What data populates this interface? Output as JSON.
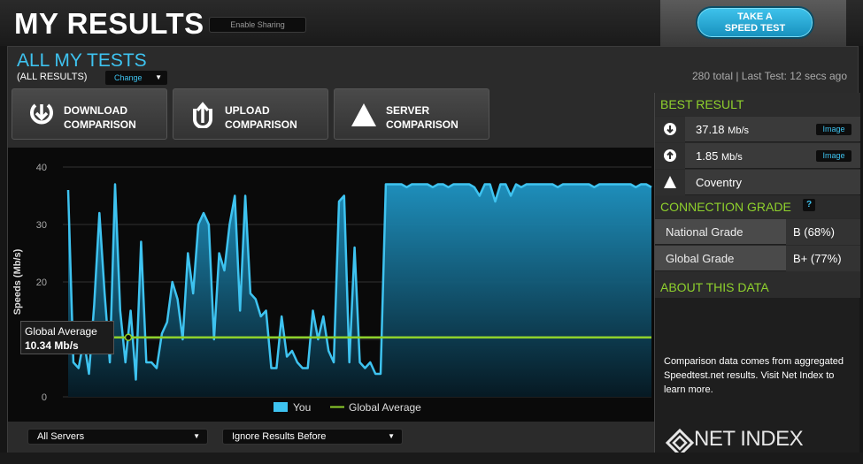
{
  "header": {
    "title": "MY RESULTS",
    "sharing_label": "Enable Sharing",
    "speedtest_line1": "TAKE A",
    "speedtest_line2": "SPEED TEST"
  },
  "section": {
    "title": "ALL MY TESTS",
    "subtitle": "(ALL RESULTS)",
    "change_label": "Change",
    "stats": "280 total | Last Test: 12 secs ago"
  },
  "comparison_buttons": [
    {
      "line1": "DOWNLOAD",
      "line2": "COMPARISON",
      "icon": "download-icon"
    },
    {
      "line1": "UPLOAD",
      "line2": "COMPARISON",
      "icon": "upload-icon"
    },
    {
      "line1": "SERVER",
      "line2": "COMPARISON",
      "icon": "server-icon"
    }
  ],
  "tooltip": {
    "line1": "Global Average",
    "line2": "10.34 Mb/s"
  },
  "filters": {
    "servers": "All Servers",
    "ignore": "Ignore Results Before"
  },
  "best_result": {
    "header": "BEST RESULT",
    "download": "37.18",
    "upload": "1.85",
    "unit": "Mb/s",
    "server": "Coventry",
    "image_label": "Image"
  },
  "connection_grade": {
    "header": "CONNECTION GRADE",
    "help": "?",
    "national_label": "National Grade",
    "national_value": "B (68%)",
    "global_label": "Global Grade",
    "global_value": "B+ (77%)"
  },
  "about": {
    "header": "ABOUT THIS DATA",
    "text": "Comparison data comes from aggregated Speedtest.net results. Visit Net Index to learn more.",
    "logo": "NET INDEX"
  },
  "colors": {
    "accent_blue": "#3ec3f0",
    "accent_green": "#8fd12c",
    "average_line": "#8fd12c"
  },
  "chart_data": {
    "type": "area",
    "ylabel": "Speeds (Mb/s)",
    "ylim": [
      0,
      40
    ],
    "yticks": [
      0,
      10,
      20,
      30,
      40
    ],
    "grid": true,
    "legend_position": "bottom",
    "series": [
      {
        "name": "You",
        "color": "#3ec3f0",
        "values": [
          36,
          6,
          5,
          10,
          4,
          16,
          32,
          18,
          6,
          37,
          15,
          6,
          15,
          3,
          27,
          6,
          6,
          5,
          11,
          13,
          20,
          17,
          10,
          25,
          18,
          30,
          32,
          30,
          10,
          25,
          22,
          30,
          35,
          15,
          35,
          18,
          17,
          14,
          15,
          5,
          5,
          14,
          7,
          8,
          6,
          5,
          5,
          15,
          10,
          14,
          8,
          6,
          34,
          35,
          6,
          26,
          6,
          5,
          6,
          4,
          4,
          37,
          37,
          37,
          37,
          36.5,
          37,
          37,
          37,
          37,
          36.5,
          37,
          37,
          36.5,
          37,
          37,
          37,
          37,
          36.5,
          35,
          37,
          37,
          34,
          37,
          37,
          35,
          37,
          36.5,
          37,
          37,
          37,
          37,
          37,
          37,
          36.5,
          37,
          37,
          37,
          37,
          37,
          37,
          36.5,
          37,
          37,
          37,
          37,
          37,
          37,
          37,
          36.5,
          37,
          37,
          36.5
        ]
      },
      {
        "name": "Global Average",
        "color": "#8fd12c",
        "value": 10.34
      }
    ]
  }
}
